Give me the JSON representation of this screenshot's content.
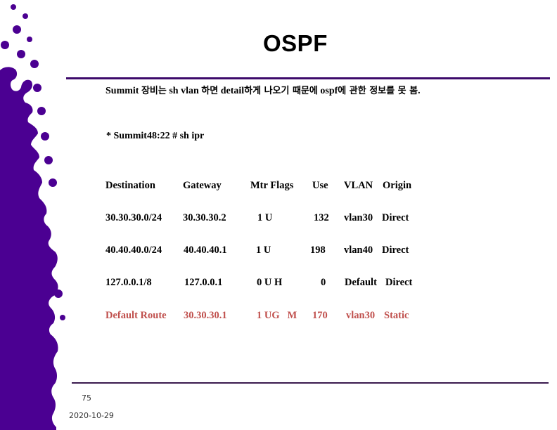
{
  "slide": {
    "title": "OSPF",
    "intro_parts": [
      {
        "text": "Summit ",
        "lang": "en"
      },
      {
        "text": "장비는",
        "lang": "ko"
      },
      {
        "text": " sh vlan ",
        "lang": "en"
      },
      {
        "text": "하면",
        "lang": "ko"
      },
      {
        "text": " detail",
        "lang": "en"
      },
      {
        "text": "하게 나오기 때문에",
        "lang": "ko"
      },
      {
        "text": " ospf",
        "lang": "en"
      },
      {
        "text": "에 관한 정보를 못 봄",
        "lang": "ko"
      },
      {
        "text": ".",
        "lang": "en"
      }
    ],
    "command": "* Summit48:22 # sh ipr",
    "accent_color": "#3d0a6b",
    "highlight_color": "#c0504d"
  },
  "route_table": {
    "headers": [
      "Destination",
      "Gateway",
      "Mtr Flags",
      "Use",
      "VLAN",
      "Origin"
    ],
    "rows": [
      {
        "destination": "30.30.30.0/24",
        "gateway": "30.30.30.2",
        "flags": "1 U",
        "use": "132",
        "vlan": "vlan30",
        "origin": "Direct",
        "highlight": false
      },
      {
        "destination": "40.40.40.0/24",
        "gateway": "40.40.40.1",
        "flags": "1 U",
        "use": "198",
        "vlan": "vlan40",
        "origin": "Direct",
        "highlight": false
      },
      {
        "destination": "127.0.0.1/8",
        "gateway": "127.0.0.1",
        "flags": "0 U H",
        "use": "0",
        "vlan": "Default",
        "origin": "Direct",
        "highlight": false
      },
      {
        "destination": "Default Route",
        "gateway": "30.30.30.1",
        "flags": "1 UG   M",
        "use": "170",
        "vlan": "vlan30",
        "origin": "Static",
        "highlight": true
      }
    ]
  },
  "footer": {
    "page_number": "75",
    "date": "2020-10-29"
  }
}
